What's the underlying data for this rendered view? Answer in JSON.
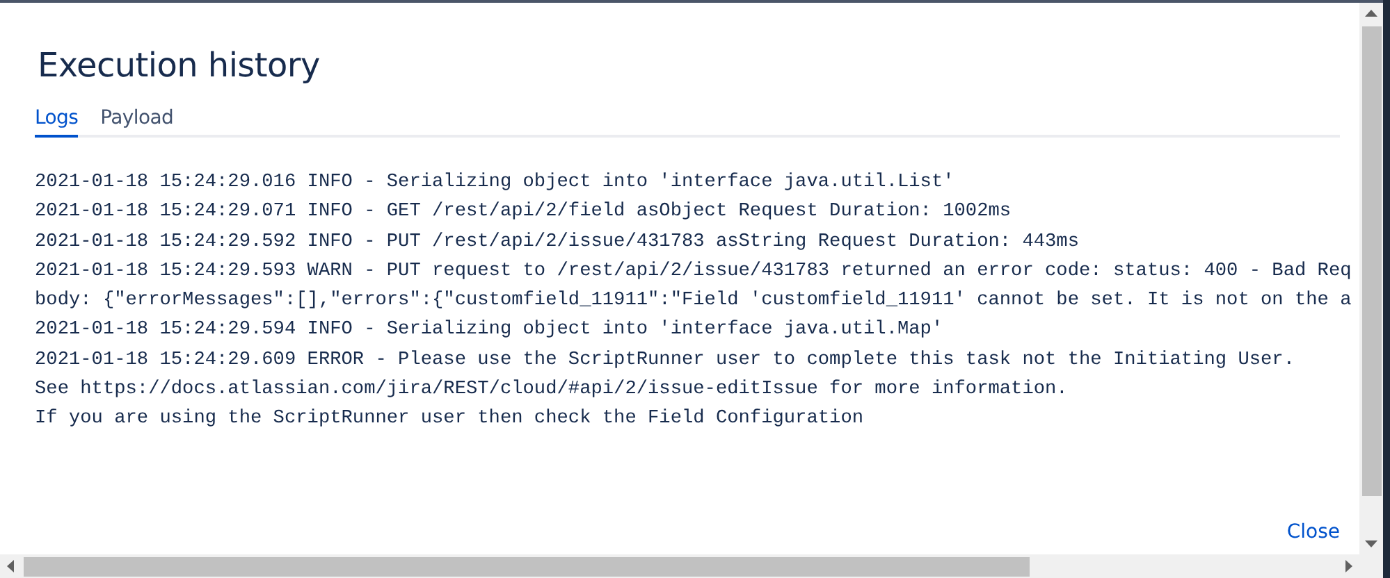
{
  "dialog": {
    "title": "Execution history",
    "tabs": [
      {
        "label": "Logs",
        "selected": true
      },
      {
        "label": "Payload",
        "selected": false
      }
    ],
    "log_lines": [
      "2021-01-18 15:24:29.016 INFO - Serializing object into 'interface java.util.List'",
      "2021-01-18 15:24:29.071 INFO - GET /rest/api/2/field asObject Request Duration: 1002ms",
      "2021-01-18 15:24:29.592 INFO - PUT /rest/api/2/issue/431783 asString Request Duration: 443ms",
      "2021-01-18 15:24:29.593 WARN - PUT request to /rest/api/2/issue/431783 returned an error code: status: 400 - Bad Req",
      "body: {\"errorMessages\":[],\"errors\":{\"customfield_11911\":\"Field 'customfield_11911' cannot be set. It is not on the a",
      "2021-01-18 15:24:29.594 INFO - Serializing object into 'interface java.util.Map'",
      "2021-01-18 15:24:29.609 ERROR - Please use the ScriptRunner user to complete this task not the Initiating User.",
      "See https://docs.atlassian.com/jira/REST/cloud/#api/2/issue-editIssue for more information.",
      "If you are using the ScriptRunner user then check the Field Configuration"
    ],
    "close_label": "Close"
  }
}
